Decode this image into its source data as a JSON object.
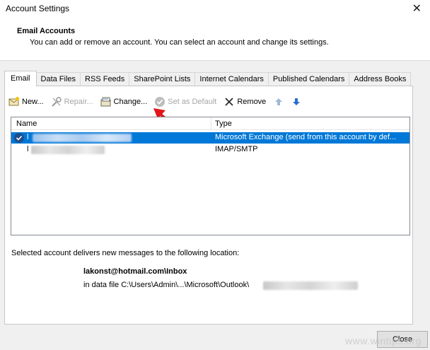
{
  "window": {
    "title": "Account Settings",
    "close_glyph": "✕"
  },
  "header": {
    "title": "Email Accounts",
    "description": "You can add or remove an account. You can select an account and change its settings."
  },
  "tabs": [
    "Email",
    "Data Files",
    "RSS Feeds",
    "SharePoint Lists",
    "Internet Calendars",
    "Published Calendars",
    "Address Books"
  ],
  "active_tab": "Email",
  "toolbar": {
    "new_label": "New...",
    "repair_label": "Repair...",
    "change_label": "Change...",
    "default_label": "Set as Default",
    "remove_label": "Remove"
  },
  "accounts": {
    "columns": {
      "name": "Name",
      "type": "Type"
    },
    "rows": [
      {
        "name": "l",
        "type": "Microsoft Exchange (send from this account by def...",
        "selected": true,
        "default": true
      },
      {
        "name": "l",
        "type": "IMAP/SMTP",
        "selected": false,
        "default": false
      }
    ]
  },
  "location": {
    "label": "Selected account delivers new messages to the following location:",
    "mailbox": "lakonst@hotmail.com\\Inbox",
    "data_file": "in data file C:\\Users\\Admin\\...\\Microsoft\\Outlook\\"
  },
  "footer": {
    "close_label": "Close"
  },
  "watermark": "www.wintips.org",
  "colors": {
    "selection": "#0078d7",
    "arrow": "#e0161c",
    "up_arrow": "#9fb8d6",
    "down_arrow": "#2a6fd0"
  }
}
